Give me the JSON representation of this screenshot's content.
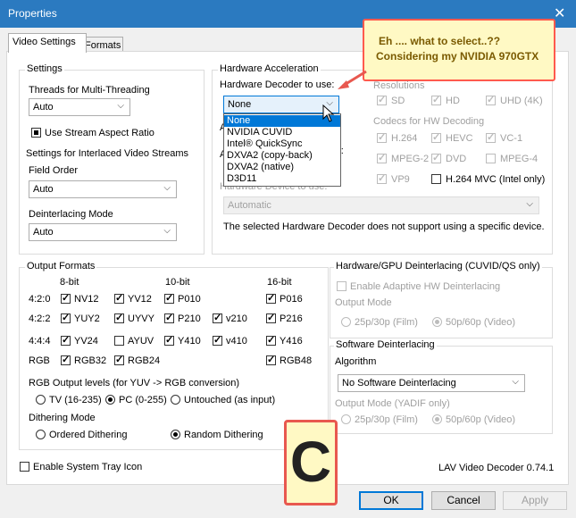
{
  "window": {
    "title": "Properties",
    "close": "✕"
  },
  "tabs": [
    {
      "label": "Video Settings"
    },
    {
      "label": "Formats"
    }
  ],
  "settings": {
    "group_label": "Settings",
    "threads_label": "Threads for Multi-Threading",
    "threads_value": "Auto",
    "stream_aspect_label": "Use Stream Aspect Ratio",
    "interlaced_label": "Settings for Interlaced Video Streams",
    "field_order_label": "Field Order",
    "field_order_value": "Auto",
    "deinterlacing_mode_label": "Deinterlacing Mode",
    "deinterlacing_mode_value": "Auto"
  },
  "hwaccel": {
    "group_label": "Hardware Acceleration",
    "decoder_label": "Hardware Decoder to use:",
    "decoder_value": "None",
    "decoder_options": [
      "None",
      "NVIDIA CUVID",
      "Intel® QuickSync",
      "DXVA2 (copy-back)",
      "DXVA2 (native)",
      "D3D11"
    ],
    "hidden_label_a": "A",
    "hidden_label_b": "or:",
    "device_label": "Hardware Device to use:",
    "device_value": "Automatic",
    "note": "The selected Hardware Decoder does not support using a specific device.",
    "resolutions_label": "Resolutions",
    "resolutions": [
      "SD",
      "HD",
      "UHD (4K)"
    ],
    "codecs_label": "Codecs for HW Decoding",
    "codecs": [
      "H.264",
      "HEVC",
      "VC-1",
      "MPEG-2",
      "DVD",
      "MPEG-4",
      "VP9",
      "H.264 MVC (Intel only)"
    ]
  },
  "output_formats": {
    "group_label": "Output Formats",
    "col_8bit": "8-bit",
    "col_10bit": "10-bit",
    "col_16bit": "16-bit",
    "row_420": "4:2:0",
    "row_422": "4:2:2",
    "row_444": "4:4:4",
    "row_rgb": "RGB",
    "nv12": "NV12",
    "yv12": "YV12",
    "p010": "P010",
    "p016": "P016",
    "yuy2": "YUY2",
    "uyvy": "UYVY",
    "p210": "P210",
    "v210": "v210",
    "p216": "P216",
    "yv24": "YV24",
    "ayuv": "AYUV",
    "y410": "Y410",
    "v410": "v410",
    "y416": "Y416",
    "rgb32": "RGB32",
    "rgb24": "RGB24",
    "rgb48": "RGB48",
    "rgb_levels_label": "RGB Output levels (for YUV -> RGB conversion)",
    "tv": "TV (16-235)",
    "pc": "PC (0-255)",
    "untouched": "Untouched (as input)",
    "dithering_label": "Dithering Mode",
    "ordered": "Ordered Dithering",
    "random": "Random Dithering"
  },
  "hw_deint": {
    "group_label": "Hardware/GPU Deinterlacing (CUVID/QS only)",
    "enable_label": "Enable Adaptive HW Deinterlacing",
    "output_mode_label": "Output Mode",
    "opt_25": "25p/30p (Film)",
    "opt_50": "50p/60p (Video)"
  },
  "sw_deint": {
    "group_label": "Software Deinterlacing",
    "algorithm_label": "Algorithm",
    "algorithm_value": "No Software Deinterlacing",
    "output_mode_label": "Output Mode (YADIF only)",
    "opt_25": "25p/30p (Film)",
    "opt_50": "50p/60p (Video)"
  },
  "footer": {
    "tray_label": "Enable System Tray Icon",
    "version": "LAV Video Decoder 0.74.1",
    "ok": "OK",
    "cancel": "Cancel",
    "apply": "Apply"
  },
  "annotation": {
    "line1": "Eh .... what to select..??",
    "line2": "Considering my NVIDIA 970GTX",
    "badge": "C"
  }
}
